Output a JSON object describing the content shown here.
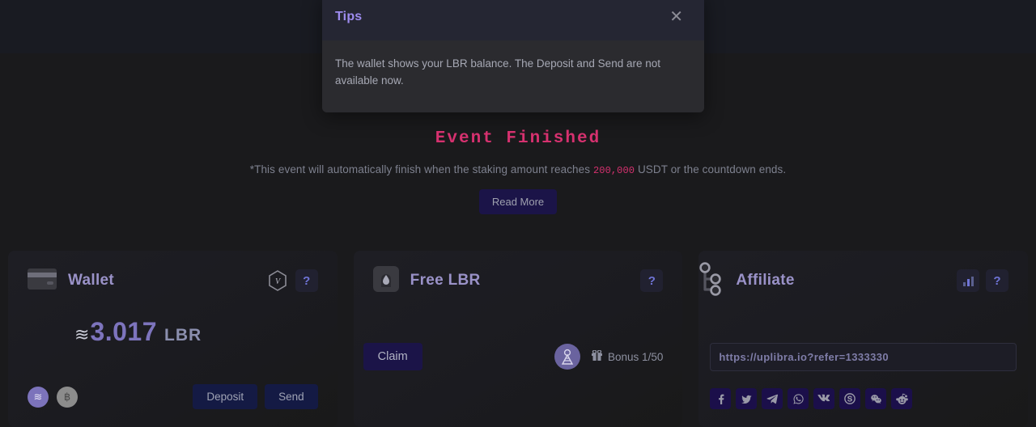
{
  "modal": {
    "title": "Tips",
    "close_icon": "close-icon",
    "body": "The wallet shows your LBR balance. The Deposit and Send are not available now."
  },
  "event": {
    "title": "Event Finished",
    "note_prefix": "*This event will automatically finish when the staking amount reaches",
    "note_amount": "200,000",
    "note_suffix": "USDT or the countdown ends.",
    "read_more": "Read More"
  },
  "wallet": {
    "title": "Wallet",
    "card_icon": "credit-card-icon",
    "verify_icon": "hexagon-v-icon",
    "help_label": "?",
    "approx": "≋",
    "balance": "3.017",
    "unit": "LBR",
    "coin_primary": "≋",
    "coin_secondary": "฿",
    "deposit_label": "Deposit",
    "send_label": "Send"
  },
  "free_lbr": {
    "title": "Free LBR",
    "flame_icon": "flame-icon",
    "help_label": "?",
    "claim_label": "Claim",
    "coin_icon": "libra-coin-icon",
    "gift_icon": "gift-icon",
    "bonus_label": "Bonus 1/50"
  },
  "affiliate": {
    "title": "Affiliate",
    "network_icon": "network-nodes-icon",
    "chart_icon": "bar-chart-icon",
    "help_label": "?",
    "referral_url": "https://uplibra.io?refer=1333330",
    "socials": [
      {
        "name": "facebook",
        "label": "Facebook"
      },
      {
        "name": "twitter",
        "label": "Twitter"
      },
      {
        "name": "telegram",
        "label": "Telegram"
      },
      {
        "name": "whatsapp",
        "label": "WhatsApp"
      },
      {
        "name": "vk",
        "label": "VK"
      },
      {
        "name": "skype",
        "label": "Skype"
      },
      {
        "name": "wechat",
        "label": "WeChat"
      },
      {
        "name": "reddit",
        "label": "Reddit"
      }
    ]
  },
  "colors": {
    "background": "#1a1a1c",
    "accent_purple": "#9a92c8",
    "accent_pink": "#d6316f",
    "button_navy": "#1b1448"
  }
}
